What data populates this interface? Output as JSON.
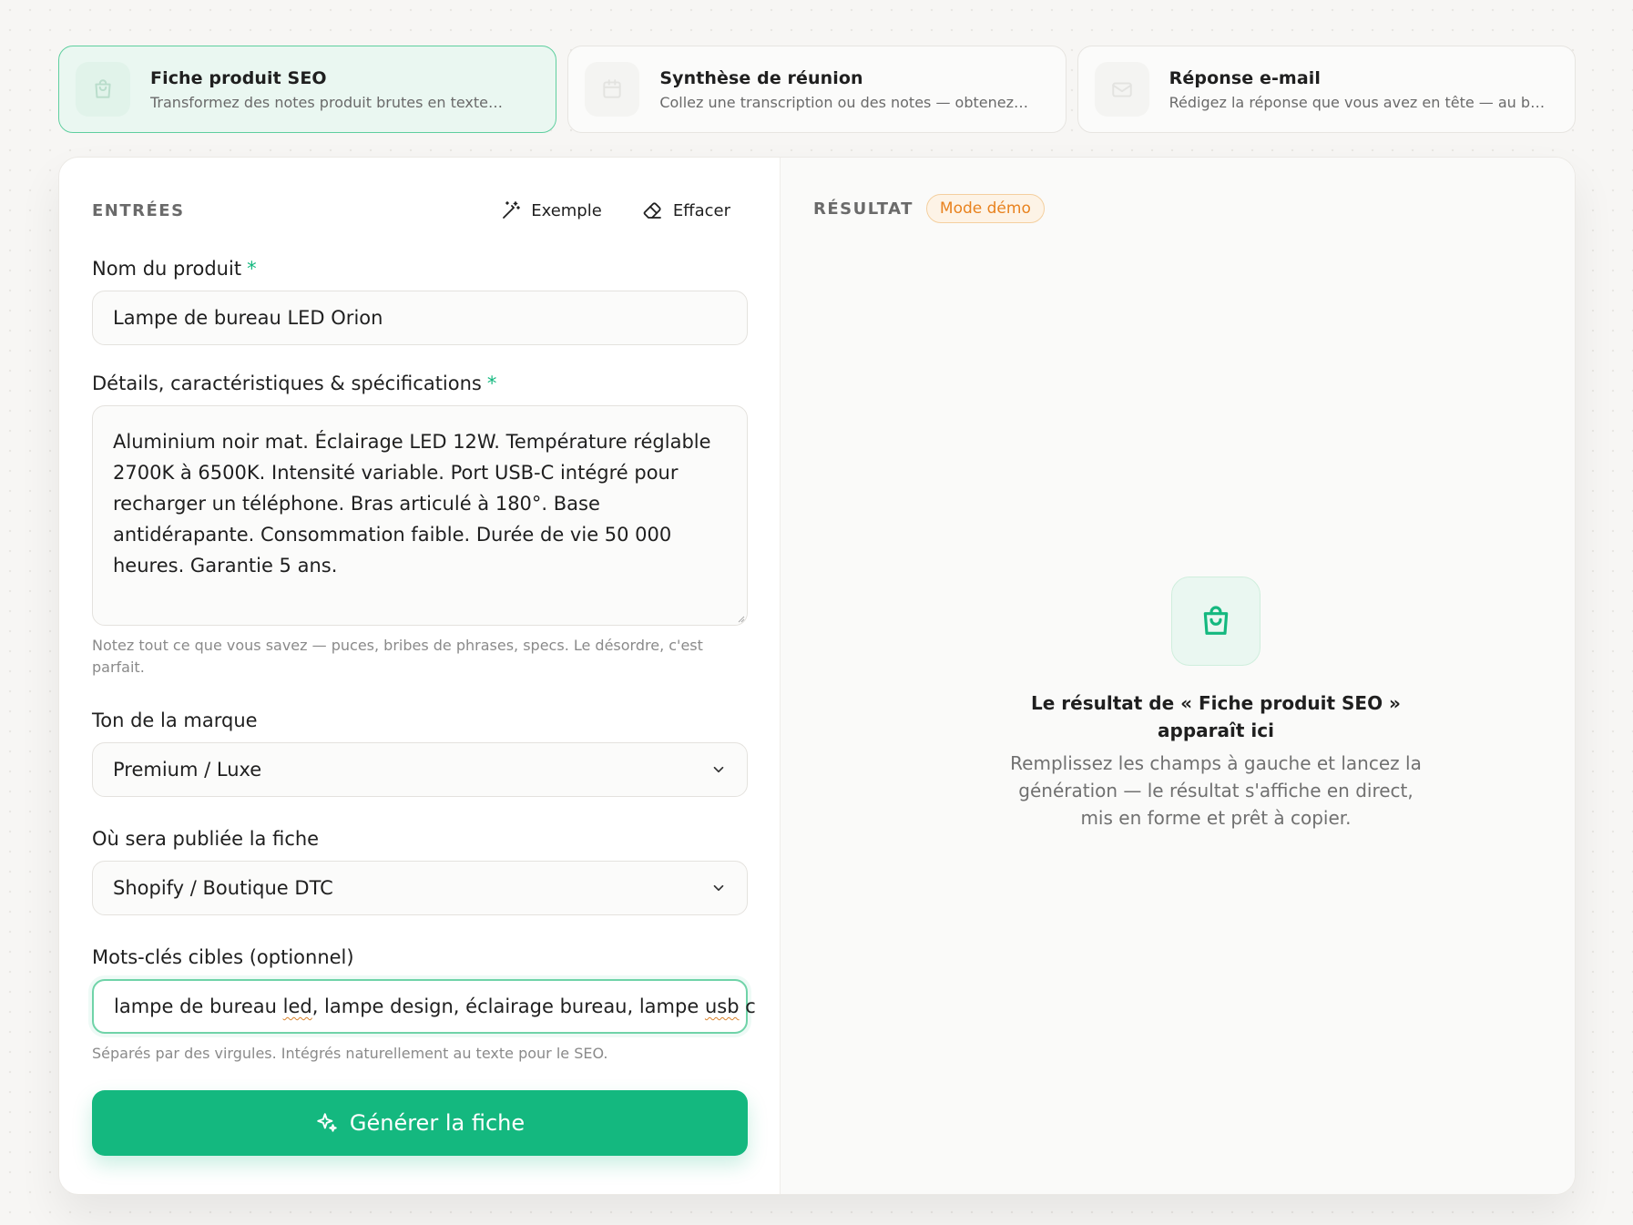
{
  "tabs": [
    {
      "title": "Fiche produit SEO",
      "desc": "Transformez des notes produit brutes en texte…",
      "icon": "shopping-bag-icon"
    },
    {
      "title": "Synthèse de réunion",
      "desc": "Collez une transcription ou des notes — obtenez…",
      "icon": "calendar-icon"
    },
    {
      "title": "Réponse e-mail",
      "desc": "Rédigez la réponse que vous avez en tête — au bo…",
      "icon": "mail-icon"
    }
  ],
  "inputs": {
    "title": "ENTRÉES",
    "example_label": "Exemple",
    "clear_label": "Effacer",
    "required_mark": "*",
    "product_name": {
      "label": "Nom du produit",
      "value": "Lampe de bureau LED Orion"
    },
    "details": {
      "label": "Détails, caractéristiques & spécifications",
      "value": "Aluminium noir mat. Éclairage LED 12W. Température réglable 2700K à 6500K. Intensité variable. Port USB-C intégré pour recharger un téléphone. Bras articulé à 180°. Base antidérapante. Consommation faible. Durée de vie 50 000 heures. Garantie 5 ans.",
      "hint": "Notez tout ce que vous savez — puces, bribes de phrases, specs. Le désordre, c'est parfait."
    },
    "tone": {
      "label": "Ton de la marque",
      "value": "Premium / Luxe"
    },
    "channel": {
      "label": "Où sera publiée la fiche",
      "value": "Shopify / Boutique DTC"
    },
    "keywords": {
      "label": "Mots-clés cibles (optionnel)",
      "value_parts": [
        "lampe de bureau ",
        "led",
        ", lampe design, éclairage bureau, lampe ",
        "usb",
        " c"
      ],
      "hint": "Séparés par des virgules. Intégrés naturellement au texte pour le SEO."
    },
    "generate_label": "Générer la fiche"
  },
  "result": {
    "title": "RÉSULTAT",
    "badge": "Mode démo",
    "empty_title": "Le résultat de « Fiche produit SEO » apparaît ici",
    "empty_desc": "Remplissez les champs à gauche et lancez la génération — le résultat s'affiche en direct, mis en forme et prêt à copier."
  },
  "colors": {
    "accent": "#14b87f",
    "badge": "#e8821e"
  }
}
